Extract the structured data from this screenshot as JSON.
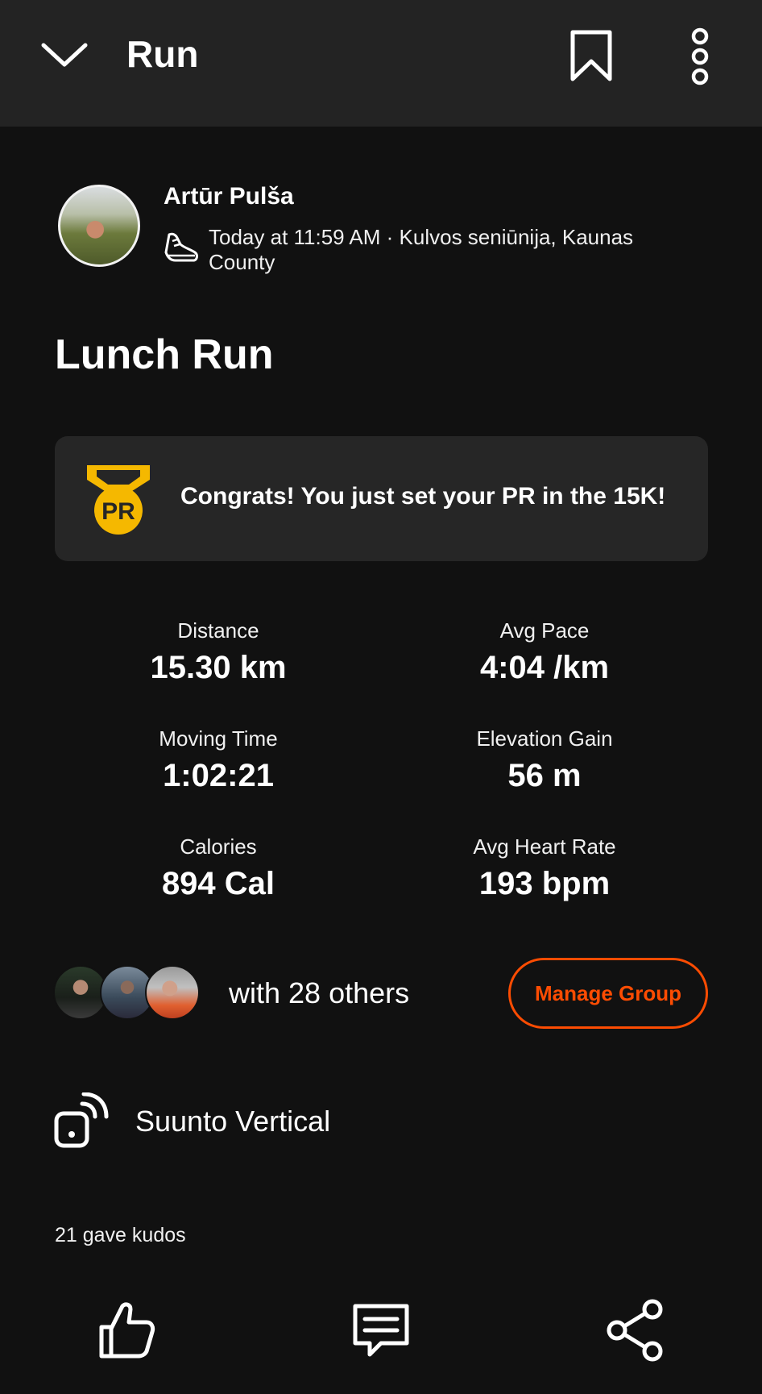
{
  "header": {
    "title": "Run"
  },
  "athlete": {
    "name": "Artūr Pulša",
    "meta": "Today at 11:59 AM · Kulvos seniūnija, Kaunas County"
  },
  "activity": {
    "title": "Lunch Run",
    "pr_message": "Congrats! You just set your PR in the 15K!",
    "medal_text": "PR"
  },
  "stats": {
    "distance": {
      "label": "Distance",
      "value": "15.30 km"
    },
    "avg_pace": {
      "label": "Avg Pace",
      "value": "4:04 /km"
    },
    "moving_time": {
      "label": "Moving Time",
      "value": "1:02:21"
    },
    "elevation_gain": {
      "label": "Elevation Gain",
      "value": "56 m"
    },
    "calories": {
      "label": "Calories",
      "value": "894 Cal"
    },
    "avg_heart_rate": {
      "label": "Avg Heart Rate",
      "value": "193 bpm"
    }
  },
  "group": {
    "text": "with 28 others",
    "manage_label": "Manage Group"
  },
  "device": {
    "name": "Suunto Vertical"
  },
  "kudos": {
    "text": "21 gave kudos"
  },
  "colors": {
    "accent": "#fc4c02",
    "medal": "#f5b800",
    "header_bg": "#232323",
    "card_bg": "#262626",
    "page_bg": "#111111"
  },
  "icons": [
    "chevron-down-icon",
    "bookmark-icon",
    "more-vertical-icon",
    "shoe-icon",
    "pr-medal-icon",
    "device-sync-icon",
    "thumbs-up-icon",
    "comment-icon",
    "share-icon"
  ]
}
